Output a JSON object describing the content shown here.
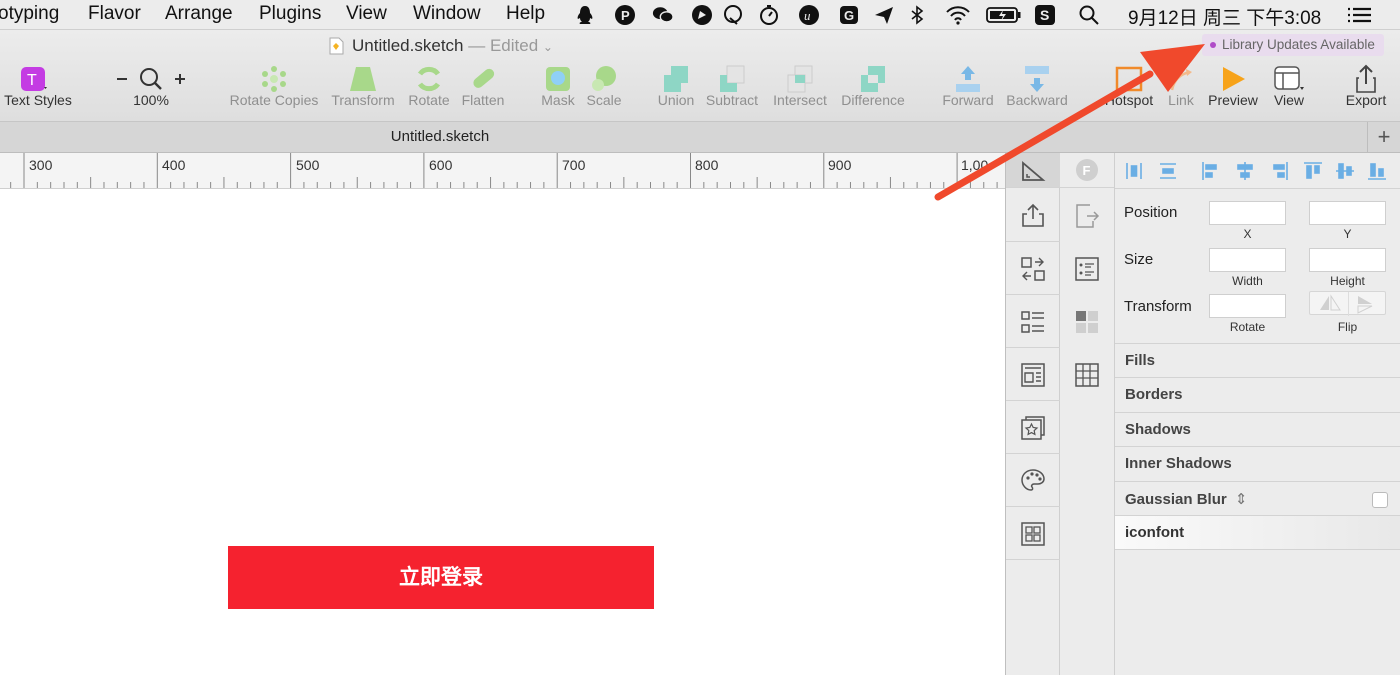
{
  "menubar": {
    "items": [
      "otyping",
      "Flavor",
      "Arrange",
      "Plugins",
      "View",
      "Window",
      "Help"
    ],
    "clock": "9月12日 周三 下午3:08"
  },
  "window": {
    "doc_title": "Untitled.sketch",
    "edited_suffix": "— Edited",
    "library_badge": "Library Updates Available"
  },
  "toolbar": {
    "text_styles": "Text Styles",
    "zoom": "100%",
    "rotate_copies": "Rotate Copies",
    "transform": "Transform",
    "rotate": "Rotate",
    "flatten": "Flatten",
    "mask": "Mask",
    "scale": "Scale",
    "union": "Union",
    "subtract": "Subtract",
    "intersect": "Intersect",
    "difference": "Difference",
    "forward": "Forward",
    "backward": "Backward",
    "hotspot": "Hotspot",
    "link": "Link",
    "preview": "Preview",
    "view": "View",
    "export": "Export"
  },
  "tab": {
    "title": "Untitled.sketch",
    "add": "+"
  },
  "ruler": {
    "labels": [
      "300",
      "400",
      "500",
      "600",
      "700",
      "800",
      "900",
      "1,00"
    ]
  },
  "canvas": {
    "button_text": "立即登录",
    "button_color": "#f5222f"
  },
  "inspector": {
    "position": "Position",
    "x": "X",
    "y": "Y",
    "size": "Size",
    "width": "Width",
    "height": "Height",
    "transform": "Transform",
    "rotate": "Rotate",
    "flip": "Flip",
    "sections": [
      "Fills",
      "Borders",
      "Shadows",
      "Inner Shadows",
      "Gaussian Blur",
      "iconfont"
    ]
  },
  "accent_arrow_color": "#f0492c"
}
